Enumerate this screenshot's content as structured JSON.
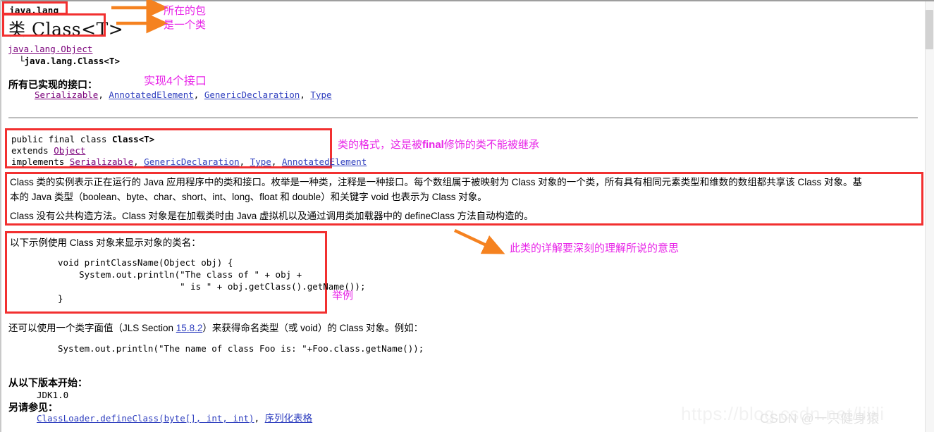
{
  "doc": {
    "package": "java.lang",
    "title_prefix": "类",
    "title_name": "Class<T>",
    "hierarchy": {
      "parent": "java.lang.Object",
      "child": "└java.lang.Class<T>"
    },
    "interfaces_heading": "所有已实现的接口：",
    "interfaces": [
      "Serializable",
      "AnnotatedElement",
      "GenericDeclaration",
      "Type"
    ],
    "signature": {
      "line1_plain": "public final class ",
      "line1_bold": "Class<T>",
      "line2_kw": "extends ",
      "line2_link": "Object",
      "line3_kw": "implements ",
      "line3_links": [
        "Serializable",
        "GenericDeclaration",
        "Type",
        "AnnotatedElement"
      ]
    },
    "description": {
      "p1_line1": "Class 类的实例表示正在运行的 Java 应用程序中的类和接口。枚举是一种类，注释是一种接口。每个数组属于被映射为 Class 对象的一个类，所有具有相同元素类型和维数的数组都共享该 Class 对象。基",
      "p1_line2": "本的 Java 类型（boolean、byte、char、short、int、long、float 和 double）和关键字 void 也表示为 Class 对象。",
      "p2": "Class 没有公共构造方法。Class 对象是在加载类时由 Java 虚拟机以及通过调用类加载器中的 defineClass 方法自动构造的。"
    },
    "example": {
      "intro": "以下示例使用 Class 对象来显示对象的类名：",
      "code": "void printClassName(Object obj) {\n    System.out.println(\"The class of \" + obj +\n                       \" is \" + obj.getClass().getName());\n}"
    },
    "literal": {
      "text_before": "还可以使用一个类字面值（JLS Section ",
      "link": "15.8.2",
      "text_after": "）来获得命名类型（或 void）的 Class 对象。例如：",
      "code": "System.out.println(\"The name of class Foo is: \"+Foo.class.getName());"
    },
    "since": {
      "heading": "从以下版本开始：",
      "value": "JDK1.0"
    },
    "see_also": {
      "heading": "另请参见：",
      "links": [
        "ClassLoader.defineClass(byte[], int, int)",
        "序列化表格"
      ]
    }
  },
  "annotations": {
    "note_package": "所在的包",
    "note_is_class": "是一个类",
    "note_interfaces": "实现4个接口",
    "note_format_a": "类的格式，这是被",
    "note_format_b": "final",
    "note_format_c": "修饰的类不能被继承",
    "note_detail": "此类的详解要深刻的理解所说的意思",
    "note_example": "举例"
  },
  "watermark": {
    "url": "https://blog.csdn.net/lilili",
    "credit": "CSDN @一只健身猿"
  },
  "colors": {
    "red_box": "#f23030",
    "magenta_note": "#e825e8",
    "orange_arrow": "#f58220",
    "link_blue": "#2f3fbf",
    "link_visited": "#7a007a"
  }
}
